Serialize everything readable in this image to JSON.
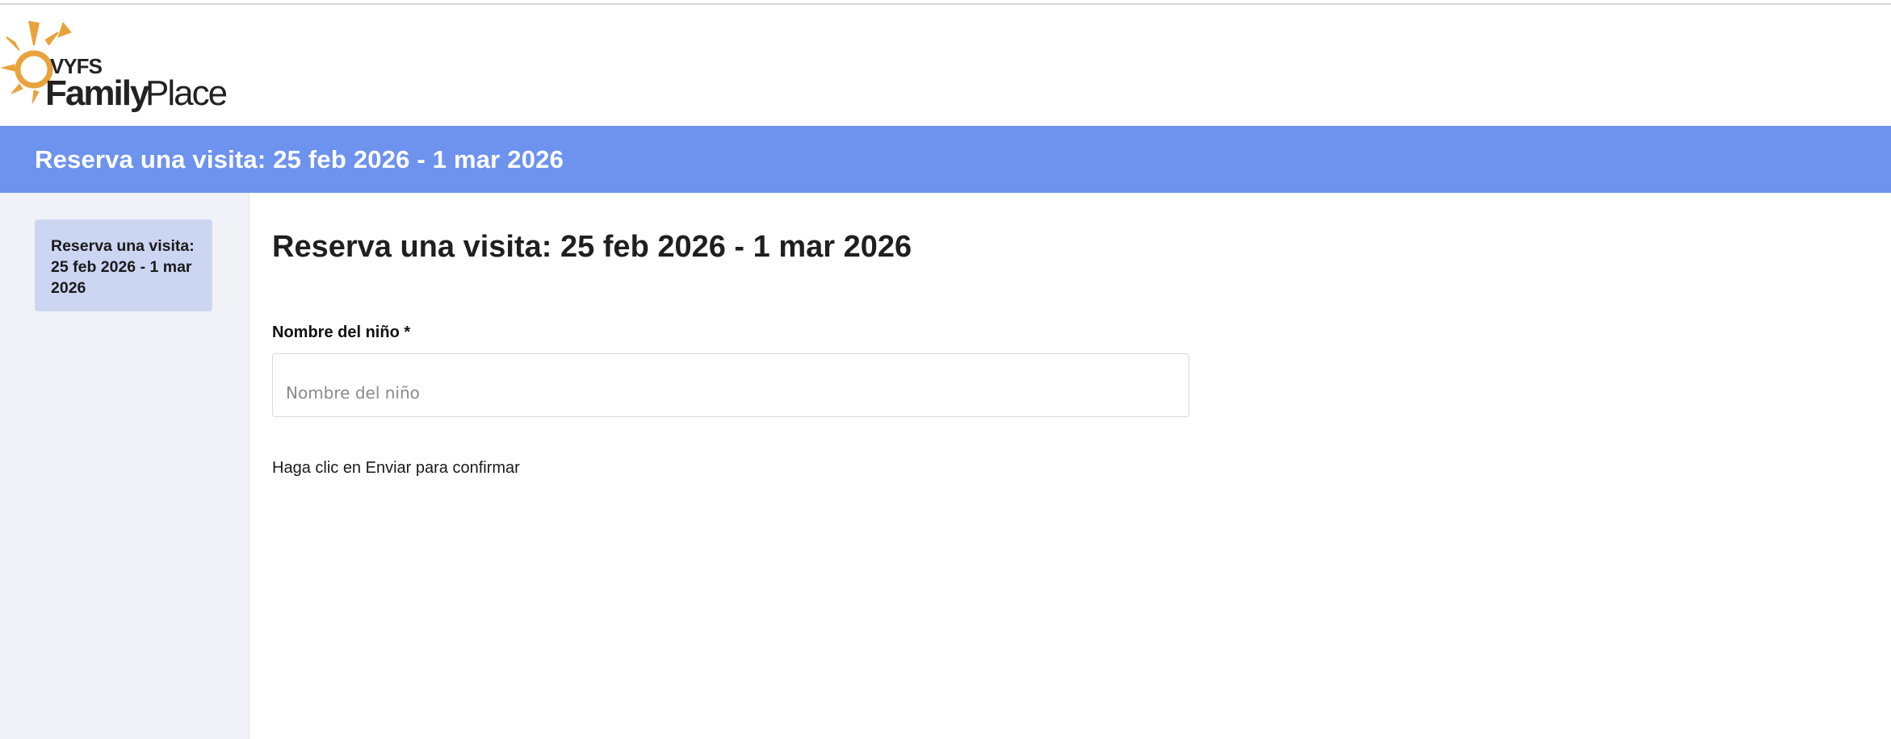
{
  "logo": {
    "brand_small": "VYFS",
    "brand_large_1": "Family",
    "brand_large_2": "Place",
    "sun_color": "#e8a33d"
  },
  "banner": {
    "title": "Reserva una visita: 25 feb 2026 - 1 mar 2026",
    "color": "#6e93ee"
  },
  "sidebar": {
    "items": [
      {
        "label": "Reserva una visita: 25 feb 2026 - 1 mar 2026",
        "active": true
      }
    ]
  },
  "main": {
    "title": "Reserva una visita: 25 feb 2026 - 1 mar 2026",
    "child_name_field": {
      "label": "Nombre del niño *",
      "placeholder": "Nombre del niño",
      "value": ""
    },
    "confirm_text": "Haga clic en Enviar para confirmar"
  }
}
